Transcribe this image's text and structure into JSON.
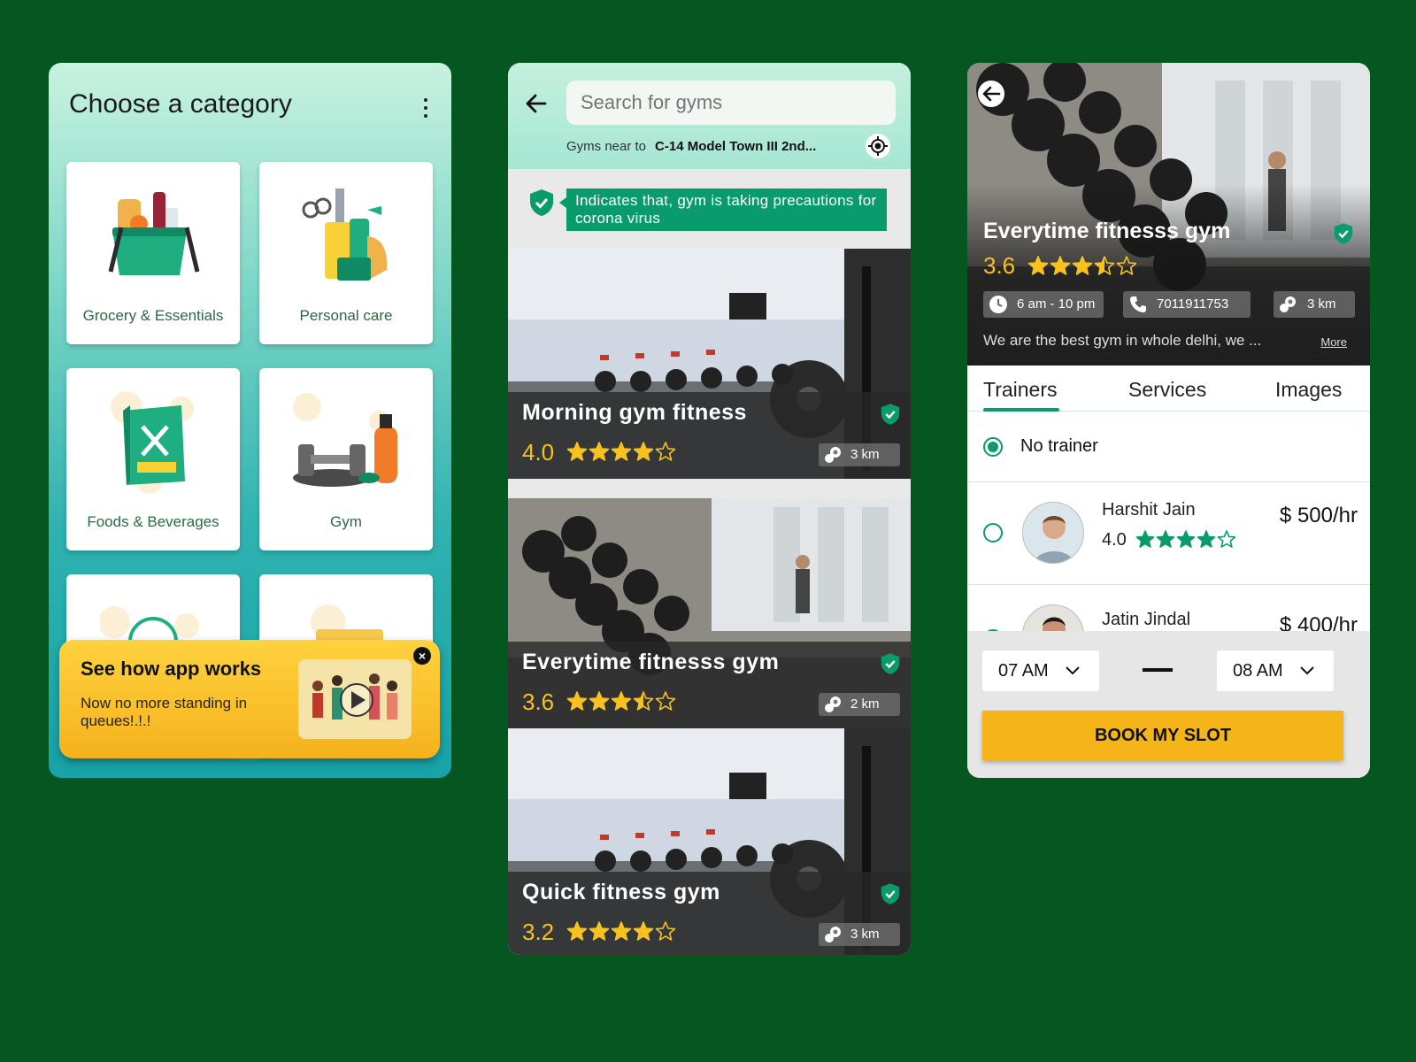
{
  "colors": {
    "page_bg": "#06561f",
    "accent_green": "#0a9b6c",
    "star_yellow": "#f7c21e",
    "book_button": "#f5b518"
  },
  "screen1": {
    "title": "Choose a category",
    "categories": [
      {
        "label": "Grocery & Essentials",
        "icon": "grocery-basket-icon"
      },
      {
        "label": "Personal care",
        "icon": "personal-care-icon"
      },
      {
        "label": "Foods & Beverages",
        "icon": "food-menu-icon"
      },
      {
        "label": "Gym",
        "icon": "dumbbell-icon"
      }
    ],
    "promo": {
      "title": "See how app works",
      "subtitle": "Now no more standing in queues!.!.!"
    }
  },
  "screen2": {
    "search_placeholder": "Search for gyms",
    "near_label": "Gyms near to",
    "near_location": "C-14 Model Town III 2nd...",
    "precaution_note": "Indicates that, gym is taking precautions for corona virus",
    "gyms": [
      {
        "name": "Morning gym fitness",
        "rating": "4.0",
        "stars": 4,
        "distance": "3 km"
      },
      {
        "name": "Everytime fitnesss gym",
        "rating": "3.6",
        "stars": 3.5,
        "distance": "2 km"
      },
      {
        "name": "Quick fitness gym",
        "rating": "3.2",
        "stars": 4,
        "distance": "3 km"
      }
    ]
  },
  "screen3": {
    "gym_name": "Everytime fitnesss gym",
    "rating": "3.6",
    "stars": 3.5,
    "hours": "6 am - 10 pm",
    "phone": "7011911753",
    "distance": "3 km",
    "description": "We are the best gym in whole delhi, we ...",
    "more_label": "More",
    "tabs": [
      "Trainers",
      "Services",
      "Images"
    ],
    "no_trainer_label": "No trainer",
    "trainers": [
      {
        "name": "Harshit Jain",
        "rating": "4.0",
        "stars": 4,
        "price": "$ 500/hr"
      },
      {
        "name": "Jatin Jindal",
        "price": "$ 400/hr"
      }
    ],
    "time_from": "07 AM",
    "time_to": "08 AM",
    "book_label": "BOOK MY SLOT"
  }
}
